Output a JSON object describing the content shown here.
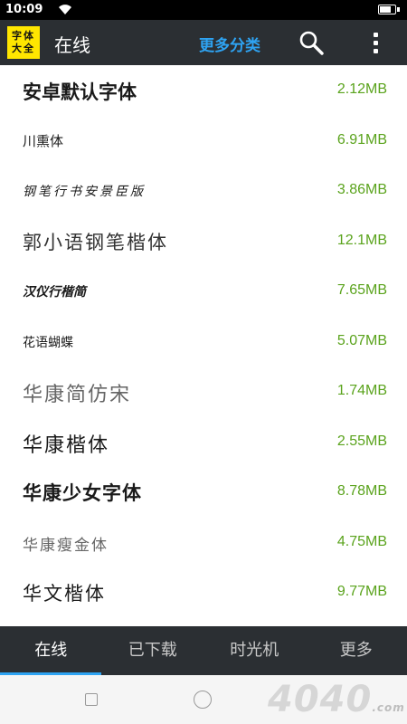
{
  "status_bar": {
    "time": "10:09",
    "battery_level": 0.85
  },
  "toolbar": {
    "logo_text": [
      "字体",
      "大全"
    ],
    "title": "在线",
    "category_label": "更多分类"
  },
  "fonts": [
    {
      "name": "安卓默认字体",
      "size": "2.12MB"
    },
    {
      "name": "川熏体",
      "size": "6.91MB"
    },
    {
      "name": "钢笔行书安景臣版",
      "size": "3.86MB"
    },
    {
      "name": "郭小语钢笔楷体",
      "size": "12.1MB"
    },
    {
      "name": "汉仪行楷简",
      "size": "7.65MB"
    },
    {
      "name": "花语蝴蝶",
      "size": "5.07MB"
    },
    {
      "name": "华康简仿宋",
      "size": "1.74MB"
    },
    {
      "name": "华康楷体",
      "size": "2.55MB"
    },
    {
      "name": "华康少女字体",
      "size": "8.78MB"
    },
    {
      "name": "华康瘦金体",
      "size": "4.75MB"
    },
    {
      "name": "华文楷体",
      "size": "9.77MB"
    }
  ],
  "tabs": [
    {
      "label": "在线",
      "active": true
    },
    {
      "label": "已下载",
      "active": false
    },
    {
      "label": "时光机",
      "active": false
    },
    {
      "label": "更多",
      "active": false
    }
  ],
  "watermark": {
    "text": "4040",
    "suffix": ".com"
  },
  "colors": {
    "toolbar_bg": "#2b2f33",
    "accent_blue": "#2ea3f2",
    "size_green": "#5aa31c",
    "logo_yellow": "#ffe600"
  }
}
